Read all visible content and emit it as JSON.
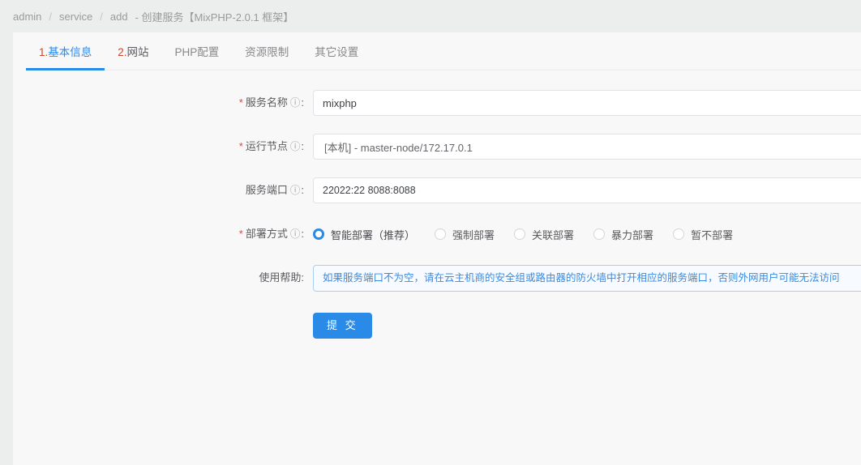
{
  "breadcrumb": {
    "items": [
      "admin",
      "service",
      "add"
    ],
    "separator": "/",
    "current": "- 创建服务【MixPHP-2.0.1 框架】"
  },
  "tabs": [
    {
      "num": "1.",
      "name": "基本信息",
      "active": true
    },
    {
      "num": "2.",
      "name": "网站",
      "active": false
    },
    {
      "num": "",
      "name": "PHP配置",
      "active": false
    },
    {
      "num": "",
      "name": "资源限制",
      "active": false
    },
    {
      "num": "",
      "name": "其它设置",
      "active": false
    }
  ],
  "form": {
    "service_name": {
      "label": "服务名称",
      "required": true,
      "help_icon": "question-circle-icon",
      "value": "mixphp",
      "placeholder": ""
    },
    "run_node": {
      "label": "运行节点",
      "required": true,
      "help_icon": "question-circle-icon",
      "value": "[本机] - master-node/172.17.0.1",
      "placeholder": ""
    },
    "service_port": {
      "label": "服务端口",
      "required": false,
      "help_icon": "question-circle-icon",
      "value": "22022:22 8088:8088",
      "placeholder": ""
    },
    "deploy_mode": {
      "label": "部署方式",
      "required": true,
      "help_icon": "question-circle-icon",
      "options": [
        {
          "label": "智能部署（推荐）",
          "checked": true
        },
        {
          "label": "强制部署",
          "checked": false
        },
        {
          "label": "关联部署",
          "checked": false
        },
        {
          "label": "暴力部署",
          "checked": false
        },
        {
          "label": "暂不部署",
          "checked": false
        }
      ]
    },
    "usage_help": {
      "label": "使用帮助",
      "required": false,
      "text": "如果服务端口不为空，请在云主机商的安全组或路由器的防火墙中打开相应的服务端口，否则外网用户可能无法访问"
    },
    "colon": "：",
    "submit_label": "提 交"
  },
  "colors": {
    "accent": "#2a8ae8",
    "required_star": "#e8413c",
    "tab_num": "#d14426",
    "help_text": "#3a8ae0",
    "help_bg": "#f7fbff",
    "help_border": "#a9cef5",
    "page_bg": "#eceded",
    "card_bg": "#f8f8f8"
  }
}
